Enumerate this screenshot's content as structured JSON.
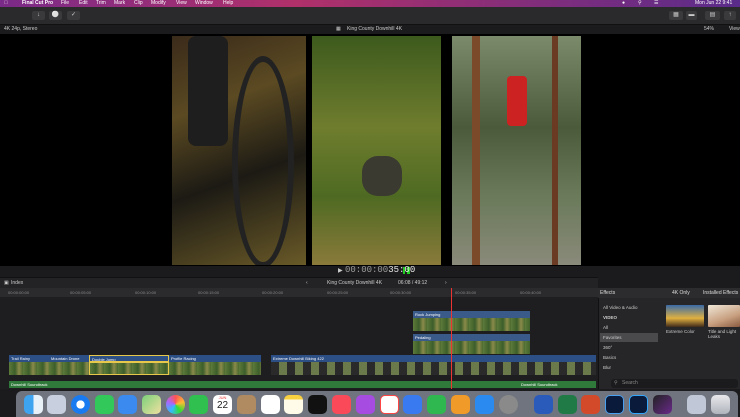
{
  "menubar": {
    "app": "Final Cut Pro",
    "items": [
      "File",
      "Edit",
      "Trim",
      "Mark",
      "Clip",
      "Modify",
      "View",
      "Window",
      "Help"
    ],
    "datetime": "Mon Jun 22  9:41"
  },
  "viewer": {
    "format": "4K 24p, Stereo",
    "title": "King County Downhill 4K",
    "zoom": "54%",
    "view_label": "View",
    "timecode_dim": "00:00:00",
    "timecode_main": "35:00"
  },
  "timeline": {
    "index_label": "Index",
    "project": "King County Downhill 4K",
    "position": "06:08 / 49:12",
    "ruler": [
      "00:00:00:00",
      "00:00:05:00",
      "00:00:10:00",
      "00:00:15:00",
      "00:00:20:00",
      "00:00:25:00",
      "00:00:30:00",
      "00:00:35:00",
      "00:00:40:00"
    ],
    "connected": [
      {
        "label": "Rock Jumping"
      },
      {
        "label": "Pedaling"
      }
    ],
    "primary": [
      {
        "label": "Trail Rainy"
      },
      {
        "label": "Mountain Drone"
      },
      {
        "label": "Double Jump"
      },
      {
        "label": "Profile Racing"
      },
      {
        "label": "Extreme Downhill Biking 422"
      }
    ],
    "audio": [
      "Downhill Soundtrack",
      "Downhill Soundtrack"
    ]
  },
  "effects": {
    "tab": "Effects",
    "filter": "4K Only",
    "installed": "Installed Effects",
    "categories": [
      "All Video & Audio",
      "VIDEO",
      "All",
      "Favorites",
      "360°",
      "Basics",
      "Blur"
    ],
    "selected_category": "Favorites",
    "thumbs": [
      {
        "label": "Extreme Color"
      },
      {
        "label": "Title and Light Leaks"
      }
    ],
    "search_placeholder": "Search"
  },
  "dock": {
    "calendar_month": "JUN",
    "calendar_day": "22"
  }
}
